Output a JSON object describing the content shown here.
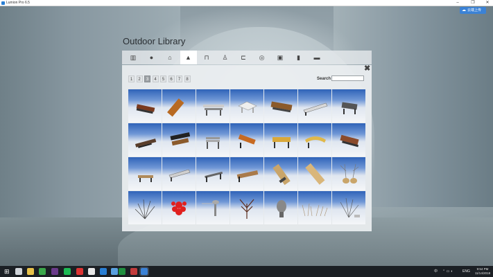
{
  "window": {
    "title": "Lumion Pro 6.5",
    "minimize_glyph": "–",
    "maximize_glyph": "❐",
    "close_glyph": "✕"
  },
  "share_button": {
    "icon": "cloud-icon",
    "label": "云端上传"
  },
  "library": {
    "title": "Outdoor Library",
    "categories": [
      {
        "icon": "fence-icon",
        "glyph": "▥"
      },
      {
        "icon": "ball-icon",
        "glyph": "●"
      },
      {
        "icon": "house-icon",
        "glyph": "⌂"
      },
      {
        "icon": "pavilion-icon",
        "glyph": "▲"
      },
      {
        "icon": "bench-icon",
        "glyph": "⊓"
      },
      {
        "icon": "lamp-icon",
        "glyph": "♙"
      },
      {
        "icon": "sofa-icon",
        "glyph": "⊏"
      },
      {
        "icon": "playground-icon",
        "glyph": "◎"
      },
      {
        "icon": "sign-icon",
        "glyph": "▣"
      },
      {
        "icon": "bin-icon",
        "glyph": "▮"
      },
      {
        "icon": "table-icon",
        "glyph": "▬"
      }
    ],
    "active_category_index": 3,
    "close_glyph": "✖",
    "pages": [
      "1",
      "2",
      "3",
      "4",
      "5",
      "6",
      "7",
      "8"
    ],
    "active_page": "3",
    "search_label": "Search",
    "search_value": "",
    "items": [
      {
        "name": "bench-wood-red"
      },
      {
        "name": "bench-plank-slanted"
      },
      {
        "name": "picnic-table-metal"
      },
      {
        "name": "picnic-table-white"
      },
      {
        "name": "bench-wood-slats"
      },
      {
        "name": "bench-modern-silver"
      },
      {
        "name": "bench-dark-frame"
      },
      {
        "name": "bench-low-dark"
      },
      {
        "name": "bench-curved-black"
      },
      {
        "name": "bench-metal-grey"
      },
      {
        "name": "bench-wood-orange"
      },
      {
        "name": "bench-yellow-seat"
      },
      {
        "name": "bench-yellow-curved"
      },
      {
        "name": "bench-brown-classic"
      },
      {
        "name": "bench-small-tan"
      },
      {
        "name": "bench-long-grey"
      },
      {
        "name": "bench-slim-dark"
      },
      {
        "name": "bench-wide-slats"
      },
      {
        "name": "bench-tilted-wood"
      },
      {
        "name": "bench-angled-wood"
      },
      {
        "name": "tree-planters-pair"
      },
      {
        "name": "bare-shrub"
      },
      {
        "name": "red-coral-sculpture"
      },
      {
        "name": "fountain-tap"
      },
      {
        "name": "antler-sculpture"
      },
      {
        "name": "stone-bust"
      },
      {
        "name": "dry-grass-clump"
      },
      {
        "name": "bare-bush-small"
      }
    ]
  },
  "taskbar": {
    "icons": [
      "start-icon",
      "task-view-icon",
      "file-explorer-icon",
      "browser-icon",
      "editor-icon",
      "spotify-icon",
      "media-icon",
      "chrome-icon",
      "edge-icon",
      "app-icon",
      "excel-icon",
      "sketchup-icon",
      "lumion-icon"
    ],
    "lang": "ENG",
    "input_mode": "中",
    "time": "9:54 PM",
    "date": "11/14/2018"
  }
}
